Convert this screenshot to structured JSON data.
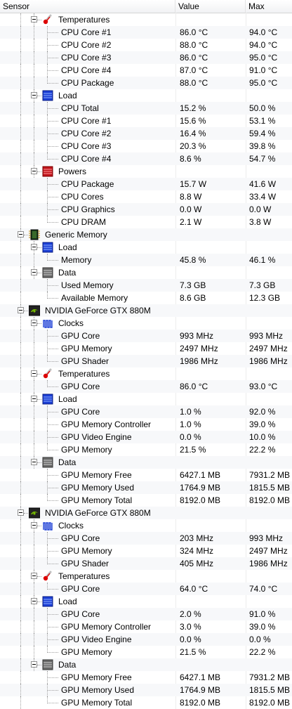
{
  "header": {
    "sensor": "Sensor",
    "value": "Value",
    "max": "Max"
  },
  "rows": [
    {
      "level": 2,
      "type": "group",
      "icon": "thermometer-icon",
      "name": "Temperatures",
      "value": "",
      "max": ""
    },
    {
      "level": 3,
      "type": "item",
      "name": "CPU Core #1",
      "value": "86.0 °C",
      "max": "94.0 °C"
    },
    {
      "level": 3,
      "type": "item",
      "name": "CPU Core #2",
      "value": "88.0 °C",
      "max": "94.0 °C"
    },
    {
      "level": 3,
      "type": "item",
      "name": "CPU Core #3",
      "value": "86.0 °C",
      "max": "95.0 °C"
    },
    {
      "level": 3,
      "type": "item",
      "name": "CPU Core #4",
      "value": "87.0 °C",
      "max": "91.0 °C"
    },
    {
      "level": 3,
      "type": "item",
      "name": "CPU Package",
      "value": "88.0 °C",
      "max": "95.0 °C"
    },
    {
      "level": 2,
      "type": "group",
      "icon": "load-icon",
      "name": "Load",
      "value": "",
      "max": ""
    },
    {
      "level": 3,
      "type": "item",
      "name": "CPU Total",
      "value": "15.2 %",
      "max": "50.0 %"
    },
    {
      "level": 3,
      "type": "item",
      "name": "CPU Core #1",
      "value": "15.6 %",
      "max": "53.1 %"
    },
    {
      "level": 3,
      "type": "item",
      "name": "CPU Core #2",
      "value": "16.4 %",
      "max": "59.4 %"
    },
    {
      "level": 3,
      "type": "item",
      "name": "CPU Core #3",
      "value": "20.3 %",
      "max": "39.8 %"
    },
    {
      "level": 3,
      "type": "item",
      "name": "CPU Core #4",
      "value": "8.6 %",
      "max": "54.7 %"
    },
    {
      "level": 2,
      "type": "group",
      "icon": "power-icon",
      "name": "Powers",
      "value": "",
      "max": ""
    },
    {
      "level": 3,
      "type": "item",
      "name": "CPU Package",
      "value": "15.7 W",
      "max": "41.6 W"
    },
    {
      "level": 3,
      "type": "item",
      "name": "CPU Cores",
      "value": "8.8 W",
      "max": "33.4 W"
    },
    {
      "level": 3,
      "type": "item",
      "name": "CPU Graphics",
      "value": "0.0 W",
      "max": "0.0 W"
    },
    {
      "level": 3,
      "type": "item",
      "name": "CPU DRAM",
      "value": "2.1 W",
      "max": "3.8 W"
    },
    {
      "level": 1,
      "type": "hardware",
      "icon": "memory-chip-icon",
      "name": "Generic Memory",
      "value": "",
      "max": ""
    },
    {
      "level": 2,
      "type": "group",
      "icon": "load-icon",
      "name": "Load",
      "value": "",
      "max": ""
    },
    {
      "level": 3,
      "type": "item",
      "name": "Memory",
      "value": "45.8 %",
      "max": "46.1 %"
    },
    {
      "level": 2,
      "type": "group",
      "icon": "data-icon",
      "name": "Data",
      "value": "",
      "max": ""
    },
    {
      "level": 3,
      "type": "item",
      "name": "Used Memory",
      "value": "7.3 GB",
      "max": "7.3 GB"
    },
    {
      "level": 3,
      "type": "item",
      "name": "Available Memory",
      "value": "8.6 GB",
      "max": "12.3 GB"
    },
    {
      "level": 1,
      "type": "hardware",
      "icon": "nvidia-gpu-icon",
      "name": "NVIDIA GeForce GTX 880M",
      "value": "",
      "max": ""
    },
    {
      "level": 2,
      "type": "group",
      "icon": "clock-icon",
      "name": "Clocks",
      "value": "",
      "max": ""
    },
    {
      "level": 3,
      "type": "item",
      "name": "GPU Core",
      "value": "993 MHz",
      "max": "993 MHz"
    },
    {
      "level": 3,
      "type": "item",
      "name": "GPU Memory",
      "value": "2497 MHz",
      "max": "2497 MHz"
    },
    {
      "level": 3,
      "type": "item",
      "name": "GPU Shader",
      "value": "1986 MHz",
      "max": "1986 MHz"
    },
    {
      "level": 2,
      "type": "group",
      "icon": "thermometer-icon",
      "name": "Temperatures",
      "value": "",
      "max": ""
    },
    {
      "level": 3,
      "type": "item",
      "name": "GPU Core",
      "value": "86.0 °C",
      "max": "93.0 °C"
    },
    {
      "level": 2,
      "type": "group",
      "icon": "load-icon",
      "name": "Load",
      "value": "",
      "max": ""
    },
    {
      "level": 3,
      "type": "item",
      "name": "GPU Core",
      "value": "1.0 %",
      "max": "92.0 %"
    },
    {
      "level": 3,
      "type": "item",
      "name": "GPU Memory Controller",
      "value": "1.0 %",
      "max": "39.0 %"
    },
    {
      "level": 3,
      "type": "item",
      "name": "GPU Video Engine",
      "value": "0.0 %",
      "max": "10.0 %"
    },
    {
      "level": 3,
      "type": "item",
      "name": "GPU Memory",
      "value": "21.5 %",
      "max": "22.2 %"
    },
    {
      "level": 2,
      "type": "group",
      "icon": "data-icon",
      "name": "Data",
      "value": "",
      "max": ""
    },
    {
      "level": 3,
      "type": "item",
      "name": "GPU Memory Free",
      "value": "6427.1 MB",
      "max": "7931.2 MB"
    },
    {
      "level": 3,
      "type": "item",
      "name": "GPU Memory Used",
      "value": "1764.9 MB",
      "max": "1815.5 MB"
    },
    {
      "level": 3,
      "type": "item",
      "name": "GPU Memory Total",
      "value": "8192.0 MB",
      "max": "8192.0 MB"
    },
    {
      "level": 1,
      "type": "hardware",
      "icon": "nvidia-gpu-icon",
      "name": "NVIDIA GeForce GTX 880M",
      "value": "",
      "max": ""
    },
    {
      "level": 2,
      "type": "group",
      "icon": "clock-icon",
      "name": "Clocks",
      "value": "",
      "max": ""
    },
    {
      "level": 3,
      "type": "item",
      "name": "GPU Core",
      "value": "203 MHz",
      "max": "993 MHz"
    },
    {
      "level": 3,
      "type": "item",
      "name": "GPU Memory",
      "value": "324 MHz",
      "max": "2497 MHz"
    },
    {
      "level": 3,
      "type": "item",
      "name": "GPU Shader",
      "value": "405 MHz",
      "max": "1986 MHz"
    },
    {
      "level": 2,
      "type": "group",
      "icon": "thermometer-icon",
      "name": "Temperatures",
      "value": "",
      "max": ""
    },
    {
      "level": 3,
      "type": "item",
      "name": "GPU Core",
      "value": "64.0 °C",
      "max": "74.0 °C"
    },
    {
      "level": 2,
      "type": "group",
      "icon": "load-icon",
      "name": "Load",
      "value": "",
      "max": ""
    },
    {
      "level": 3,
      "type": "item",
      "name": "GPU Core",
      "value": "2.0 %",
      "max": "91.0 %"
    },
    {
      "level": 3,
      "type": "item",
      "name": "GPU Memory Controller",
      "value": "3.0 %",
      "max": "39.0 %"
    },
    {
      "level": 3,
      "type": "item",
      "name": "GPU Video Engine",
      "value": "0.0 %",
      "max": "0.0 %"
    },
    {
      "level": 3,
      "type": "item",
      "name": "GPU Memory",
      "value": "21.5 %",
      "max": "22.2 %"
    },
    {
      "level": 2,
      "type": "group",
      "icon": "data-icon",
      "name": "Data",
      "value": "",
      "max": ""
    },
    {
      "level": 3,
      "type": "item",
      "name": "GPU Memory Free",
      "value": "6427.1 MB",
      "max": "7931.2 MB"
    },
    {
      "level": 3,
      "type": "item",
      "name": "GPU Memory Used",
      "value": "1764.9 MB",
      "max": "1815.5 MB"
    },
    {
      "level": 3,
      "type": "item",
      "name": "GPU Memory Total",
      "value": "8192.0 MB",
      "max": "8192.0 MB"
    }
  ]
}
